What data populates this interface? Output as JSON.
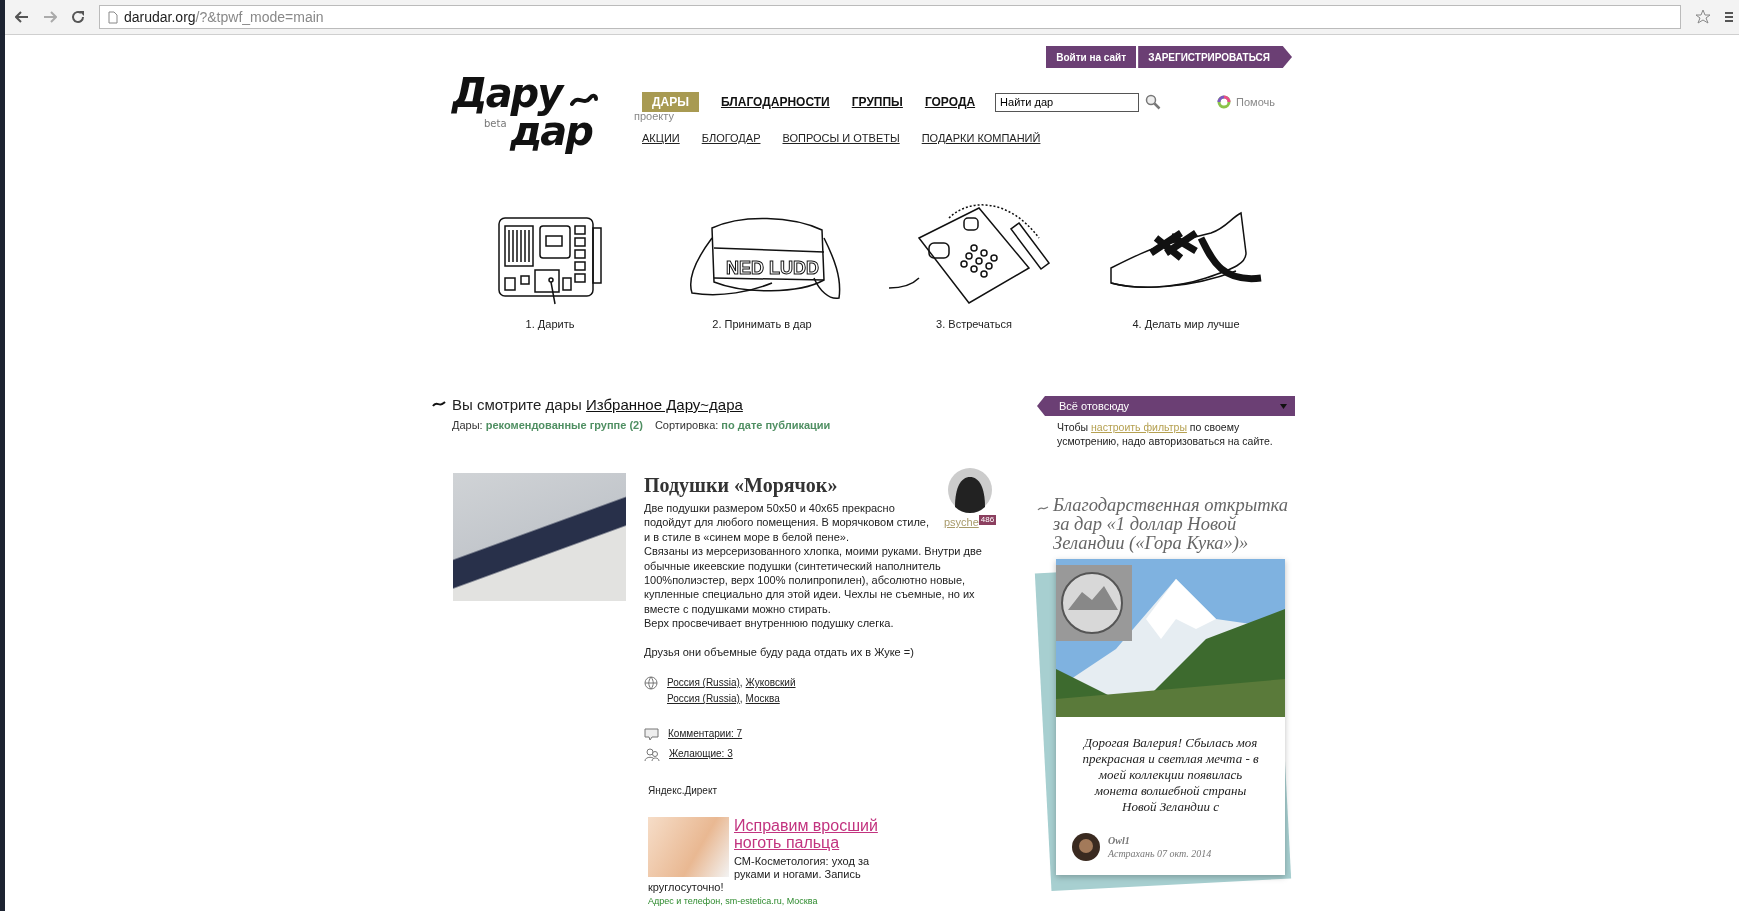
{
  "browser": {
    "url_host": "darudar.org",
    "url_path": "/?&tpwf_mode=main"
  },
  "auth_buttons": [
    {
      "label": "Войти на сайт"
    },
    {
      "label": "ЗАРЕГИСТРИРОВАТЬСЯ"
    }
  ],
  "logo": {
    "word_1": "Дару",
    "word_2": "дар",
    "badge": "beta"
  },
  "nav": [
    {
      "label": "ДАРЫ",
      "selected": true
    },
    {
      "label": "БЛАГОДАРНОСТИ",
      "selected": false
    },
    {
      "label": "ГРУППЫ",
      "selected": false
    },
    {
      "label": "ГОРОДА",
      "selected": false
    }
  ],
  "nav_note": "проекту",
  "search": {
    "value": "Найти дар"
  },
  "help_link": "Помочь",
  "subnav": [
    "АКЦИИ",
    "БЛОГОДАР",
    "ВОПРОСЫ И ОТВЕТЫ",
    "ПОДАРКИ КОМПАНИЙ"
  ],
  "steps": [
    {
      "kind": "radio",
      "caption": "1. Дарить"
    },
    {
      "kind": "bag",
      "caption": "2. Принимать в дар",
      "print": "NED LUDD"
    },
    {
      "kind": "phone",
      "caption": "3. Встречаться"
    },
    {
      "kind": "sneaker",
      "caption": "4. Делать мир лучше"
    }
  ],
  "feed_heading": {
    "text": "Вы смотрите дары",
    "link": "Избранное Дару~дара"
  },
  "filters": [
    {
      "label": "Дары:",
      "value": "рекомендованные группе (2)"
    },
    {
      "label": "Сортировка:",
      "value": "по дате публикации"
    }
  ],
  "gift": {
    "title": "Подушки «Морячок»",
    "author": "psyche",
    "author_badge": "486",
    "paragraphs": [
      "Две подушки размером 50х50 и 40х65 прекрасно подойдут для любого помещения. В морячковом стиле, и в стиле в «синем море в белой пене».",
      "Связаны из мерсеризованного хлопка, моими руками. Внутри две обычные икеевские подушки (синтетический наполнитель 100%полиэстер, верх 100% полипропилен), абсолютно новые, купленные специально для этой идеи. Чехлы не съемные, но их вместе с подушками можно стирать.",
      "Верх просвечивает внутреннюю подушку слегка.",
      "Друзья они объемные буду рада отдать их в Жуке =)"
    ],
    "locations": [
      {
        "country": "Россия (Russia)",
        "separator": ",",
        "city": "Жуковский"
      },
      {
        "country": "Россия (Russia)",
        "separator": ",",
        "city": "Москва"
      }
    ],
    "comments": "Комментарии: 7",
    "wishers": "Желающие: 3"
  },
  "ad": {
    "label": "Яндекс.Директ",
    "title": "Исправим вросший ноготь пальца",
    "text": "СМ-Косметология: уход за руками и ногами. Запись круглосуточно!",
    "contacts": "Адрес и телефон, sm-estetica.ru, Москва"
  },
  "region_dropdown": {
    "value": "Всё отовсюду"
  },
  "filter_hint": {
    "before": "Чтобы",
    "link": "настроить фильтры",
    "after": "по своему усмотрению, надо авторизоваться на сайте."
  },
  "thanks": {
    "heading": "Благодарственная открытка за дар «1 доллар Новой Зеландии («Гора Кука»)»",
    "message": "Дорогая Валерия! Сбылась моя прекрасная и светлая мечта - в моей коллекции появилась монета волшебной страны Новой Зеландии с",
    "author": "Owl1",
    "place_date": "Астрахань 07 окт. 2014"
  }
}
